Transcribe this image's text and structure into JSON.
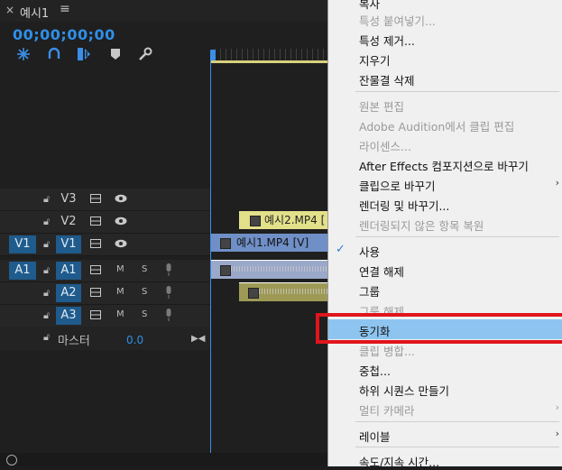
{
  "tab": {
    "close": "×",
    "title": "예시1",
    "menu_icon": "≡"
  },
  "timecode": "00;00;00;00",
  "tools": [
    "snap-icon",
    "link-icon",
    "marker-add-icon",
    "marker-icon",
    "wrench-icon"
  ],
  "tracks": {
    "v3": {
      "name": "V3"
    },
    "v2": {
      "name": "V2"
    },
    "v1": {
      "source": "V1",
      "name": "V1"
    },
    "a1": {
      "source": "A1",
      "name": "A1",
      "m": "M",
      "s": "S"
    },
    "a2": {
      "name": "A2",
      "m": "M",
      "s": "S"
    },
    "a3": {
      "name": "A3",
      "m": "M",
      "s": "S"
    },
    "master": {
      "label": "마스터",
      "value": "0.0"
    }
  },
  "clips": {
    "v2": "예시2.MP4 [",
    "v1": "예시1.MP4 [V]"
  },
  "menu": {
    "items": [
      {
        "label": "복사",
        "disabled": false
      },
      {
        "label": "특성 붙여넣기...",
        "disabled": true
      },
      {
        "label": "특성 제거...",
        "disabled": false
      },
      {
        "label": "지우기",
        "disabled": false
      },
      {
        "label": "잔물결 삭제",
        "disabled": false
      },
      {
        "label": "원본 편집",
        "disabled": true
      },
      {
        "label": "Adobe Audition에서 클립 편집",
        "disabled": true
      },
      {
        "label": "라이센스...",
        "disabled": true
      },
      {
        "label": "After Effects 컴포지션으로 바꾸기",
        "disabled": false
      },
      {
        "label": "클립으로 바꾸기",
        "disabled": false
      },
      {
        "label": "렌더링 및 바꾸기...",
        "disabled": false
      },
      {
        "label": "렌더링되지 않은 항목 복원",
        "disabled": true
      },
      {
        "label": "사용",
        "disabled": false
      },
      {
        "label": "연결 해제",
        "disabled": false
      },
      {
        "label": "그룹",
        "disabled": false
      },
      {
        "label": "그룹 해제",
        "disabled": true
      },
      {
        "label": "동기화",
        "disabled": false
      },
      {
        "label": "클립 병합...",
        "disabled": true
      },
      {
        "label": "중첩...",
        "disabled": false
      },
      {
        "label": "하위 시퀀스 만들기",
        "disabled": false
      },
      {
        "label": "멀티 카메라",
        "disabled": true
      },
      {
        "label": "레이블",
        "disabled": false
      },
      {
        "label": "속도/지속 시간...",
        "disabled": false
      }
    ],
    "check_mark": "✓",
    "submenu_arrow": "›"
  },
  "colors": {
    "accent_blue": "#2f8fe8",
    "track_active": "#1f5b8c",
    "clip_video2": "#e3e08a",
    "clip_video1": "#6f8fc6",
    "clip_audio1": "#9aa8c9",
    "clip_audio2": "#9e9a56",
    "menu_highlight": "#8ec5f0",
    "red_outline": "#e0151c"
  }
}
